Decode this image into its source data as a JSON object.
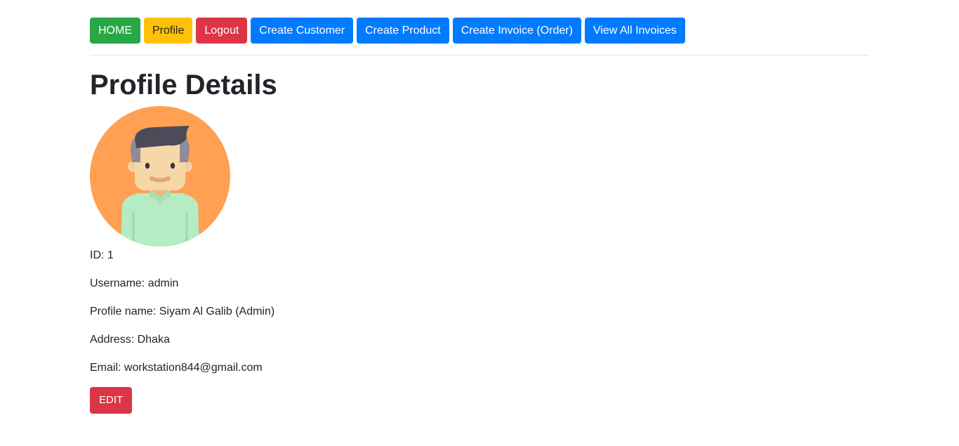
{
  "nav": {
    "home": "HOME",
    "profile": "Profile",
    "logout": "Logout",
    "create_customer": "Create Customer",
    "create_product": "Create Product",
    "create_invoice": "Create Invoice (Order)",
    "view_invoices": "View All Invoices"
  },
  "page": {
    "title": "Profile Details"
  },
  "profile": {
    "avatar_icon": "user-avatar-icon",
    "id": "ID: 1",
    "username": "Username: admin",
    "profile_name": "Profile name: Siyam Al Galib (Admin)",
    "address": "Address: Dhaka",
    "email": "Email: workstation844@gmail.com"
  },
  "actions": {
    "edit_label": "EDIT"
  },
  "colors": {
    "success": "#28a745",
    "warning": "#ffc107",
    "danger": "#dc3545",
    "primary": "#007bff",
    "avatar_bg": "#ffa052"
  }
}
